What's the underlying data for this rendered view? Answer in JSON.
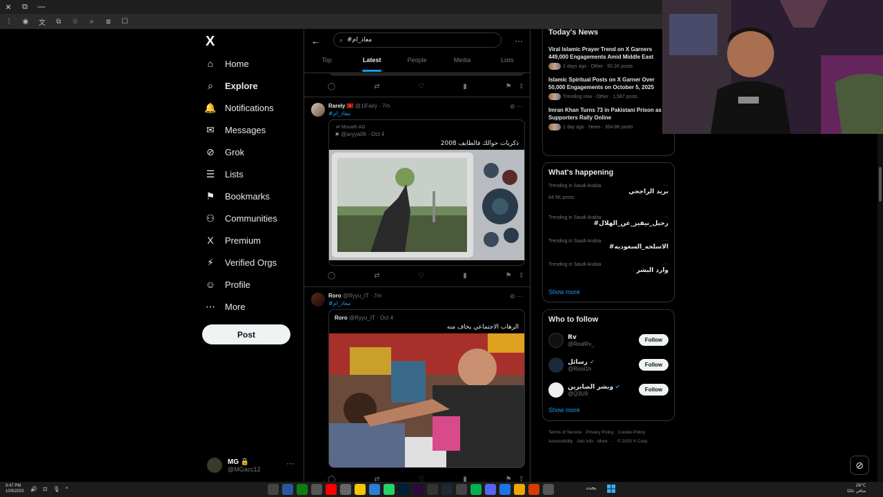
{
  "search": {
    "query": "#معاذ_ام"
  },
  "tabs": [
    "Top",
    "Latest",
    "People",
    "Media",
    "Lists"
  ],
  "nav": {
    "logo": "X",
    "items": [
      {
        "label": "Home",
        "icon": "⌂"
      },
      {
        "label": "Explore",
        "icon": "⌕"
      },
      {
        "label": "Notifications",
        "icon": "🔔"
      },
      {
        "label": "Messages",
        "icon": "✉"
      },
      {
        "label": "Grok",
        "icon": "⊘"
      },
      {
        "label": "Lists",
        "icon": "☰"
      },
      {
        "label": "Bookmarks",
        "icon": "⚑"
      },
      {
        "label": "Communities",
        "icon": "⚇"
      },
      {
        "label": "Premium",
        "icon": "X"
      },
      {
        "label": "Verified Orgs",
        "icon": "⚡"
      },
      {
        "label": "Profile",
        "icon": "☺"
      },
      {
        "label": "More",
        "icon": "⋯"
      }
    ],
    "post_label": "Post"
  },
  "account": {
    "name": "MG 🔒",
    "handle": "@MGacc12"
  },
  "tweets": [
    {
      "name": "Rarely 🇲🇪",
      "handle": "@1iFairy · 7m",
      "tag": "#معاذ_ام",
      "quote_repost": "⇄ Mouath AG",
      "quote_name": "☀",
      "quote_handle": "@aryya06 · Oct 4",
      "quote_text": "ذكريات حوالك فالطايف 2008"
    },
    {
      "name": "Roro",
      "handle": "@Ryyu_IT · 7m",
      "tag": "#معاذ_ام",
      "quote_name": "Roro",
      "quote_handle": "@Ryyu_IT · Oct 4",
      "quote_text": "الرهاب الاجتماعي يخاف منه"
    }
  ],
  "news": {
    "title": "Today's News",
    "items": [
      {
        "title": "Viral Islamic Prayer Trend on X Garners 449,000 Engagements Amid Middle East",
        "meta": "2 days ago · Other · 50.2K posts"
      },
      {
        "title": "Islamic Spiritual Posts on X Garner Over 50,000 Engagements on October 5, 2025",
        "meta": "Trending now · Other · 1,587 posts"
      },
      {
        "title": "Imran Khan Turns 73 in Pakistani Prison as Supporters Rally Online",
        "meta": "1 day ago · News · 304.8K posts"
      }
    ]
  },
  "happening": {
    "title": "What's happening",
    "trends": [
      {
        "label": "Trending in Saudi Arabia",
        "title": "بريد الراجحي",
        "posts": "64.5K posts"
      },
      {
        "label": "Trending in Saudi Arabia",
        "title": "#رحيل_نيفيز_عن_الهلال",
        "posts": ""
      },
      {
        "label": "Trending in Saudi Arabia",
        "title": "#الاسلحه_السعوديه",
        "posts": ""
      },
      {
        "label": "Trending in Saudi Arabia",
        "title": "وارد البشر",
        "posts": ""
      }
    ],
    "show_more": "Show more"
  },
  "follow": {
    "title": "Who to follow",
    "users": [
      {
        "name": "Rv",
        "handle": "@RealRv_",
        "verified": false
      },
      {
        "name": "رسائل",
        "handle": "@Rissl1h",
        "verified": true
      },
      {
        "name": "وبشر الصابرين",
        "handle": "@Q3U9",
        "verified": true
      }
    ],
    "follow_label": "Follow",
    "show_more": "Show more"
  },
  "footer": [
    "Terms of Service",
    "Privacy Policy",
    "Cookie Policy",
    "Accessibility",
    "Ads info",
    "More ···",
    "© 2025 X Corp."
  ],
  "taskbar": {
    "time": "9:47 PM",
    "date": "10/5/2025",
    "search": "بحث",
    "weather_temp": "28°C",
    "weather_text": "صافي غالبًا"
  },
  "colors": {
    "accent": "#1d9bf0",
    "background": "#000000",
    "border": "#2f3336"
  }
}
